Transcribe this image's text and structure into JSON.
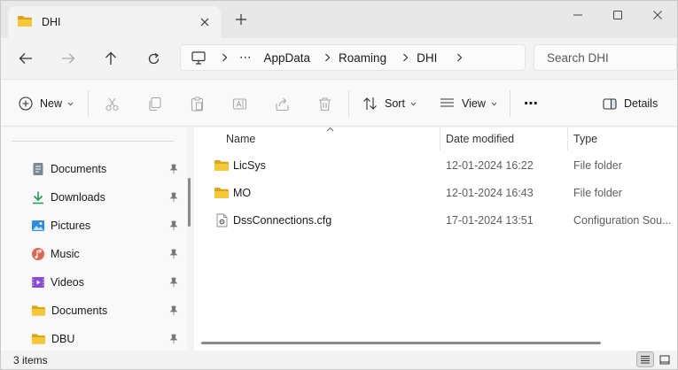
{
  "window": {
    "tab_title": "DHI"
  },
  "address": {
    "more": "⋯",
    "crumbs": [
      "AppData",
      "Roaming",
      "DHI"
    ]
  },
  "search": {
    "placeholder": "Search DHI"
  },
  "commandbar": {
    "new_label": "New",
    "sort_label": "Sort",
    "view_label": "View",
    "more_label": "⋯",
    "details_label": "Details"
  },
  "navpane": {
    "items": [
      {
        "label": "Documents",
        "icon": "documents-icon"
      },
      {
        "label": "Downloads",
        "icon": "downloads-icon"
      },
      {
        "label": "Pictures",
        "icon": "pictures-icon"
      },
      {
        "label": "Music",
        "icon": "music-icon"
      },
      {
        "label": "Videos",
        "icon": "videos-icon"
      },
      {
        "label": "Documents",
        "icon": "folder-icon"
      },
      {
        "label": "DBU",
        "icon": "folder-icon"
      }
    ]
  },
  "columns": {
    "name": "Name",
    "date": "Date modified",
    "type": "Type"
  },
  "files": [
    {
      "name": "LicSys",
      "date": "12-01-2024 16:22",
      "type": "File folder",
      "icon": "folder-icon"
    },
    {
      "name": "MO",
      "date": "12-01-2024 16:43",
      "type": "File folder",
      "icon": "folder-icon"
    },
    {
      "name": "DssConnections.cfg",
      "date": "17-01-2024 13:51",
      "type": "Configuration Sou...",
      "icon": "config-file-icon"
    }
  ],
  "status": {
    "item_count": "3 items"
  },
  "colors": {
    "folder": "#f2c12e",
    "folder_dark": "#dea419",
    "accent": "#0067c0"
  }
}
